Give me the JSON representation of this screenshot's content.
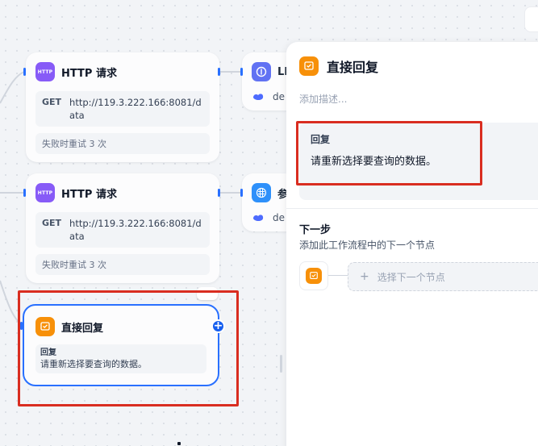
{
  "canvas": {
    "http_nodes": [
      {
        "title": "HTTP 请求",
        "icon_text": "HTTP",
        "method": "GET",
        "url": "http://119.3.222.166:8081/data",
        "retry": "失败时重试 3 次"
      },
      {
        "title": "HTTP 请求",
        "icon_text": "HTTP",
        "method": "GET",
        "url": "http://119.3.222.166:8081/data",
        "retry": "失败时重试 3 次"
      }
    ],
    "partial_nodes": [
      {
        "title": "LL",
        "sub": "de"
      },
      {
        "title": "参",
        "sub": "de"
      }
    ],
    "answer_node": {
      "title": "直接回复",
      "label": "回复",
      "text": "请重新选择要查询的数据。",
      "more": "···",
      "add": "+"
    }
  },
  "panel": {
    "title": "直接回复",
    "description_placeholder": "添加描述...",
    "answer_label": "回复",
    "answer_text": "请重新选择要查询的数据。",
    "next_step_title": "下一步",
    "next_step_desc": "添加此工作流程中的下一个节点",
    "select_next": "选择下一个节点",
    "plus": "+"
  },
  "colors": {
    "accent": "#2970ff",
    "highlight": "#d92d20",
    "answer_icon": "#f79009",
    "http_icon": "#875bf7",
    "llm_icon": "#6172f3",
    "param_icon": "#2e90fa"
  }
}
